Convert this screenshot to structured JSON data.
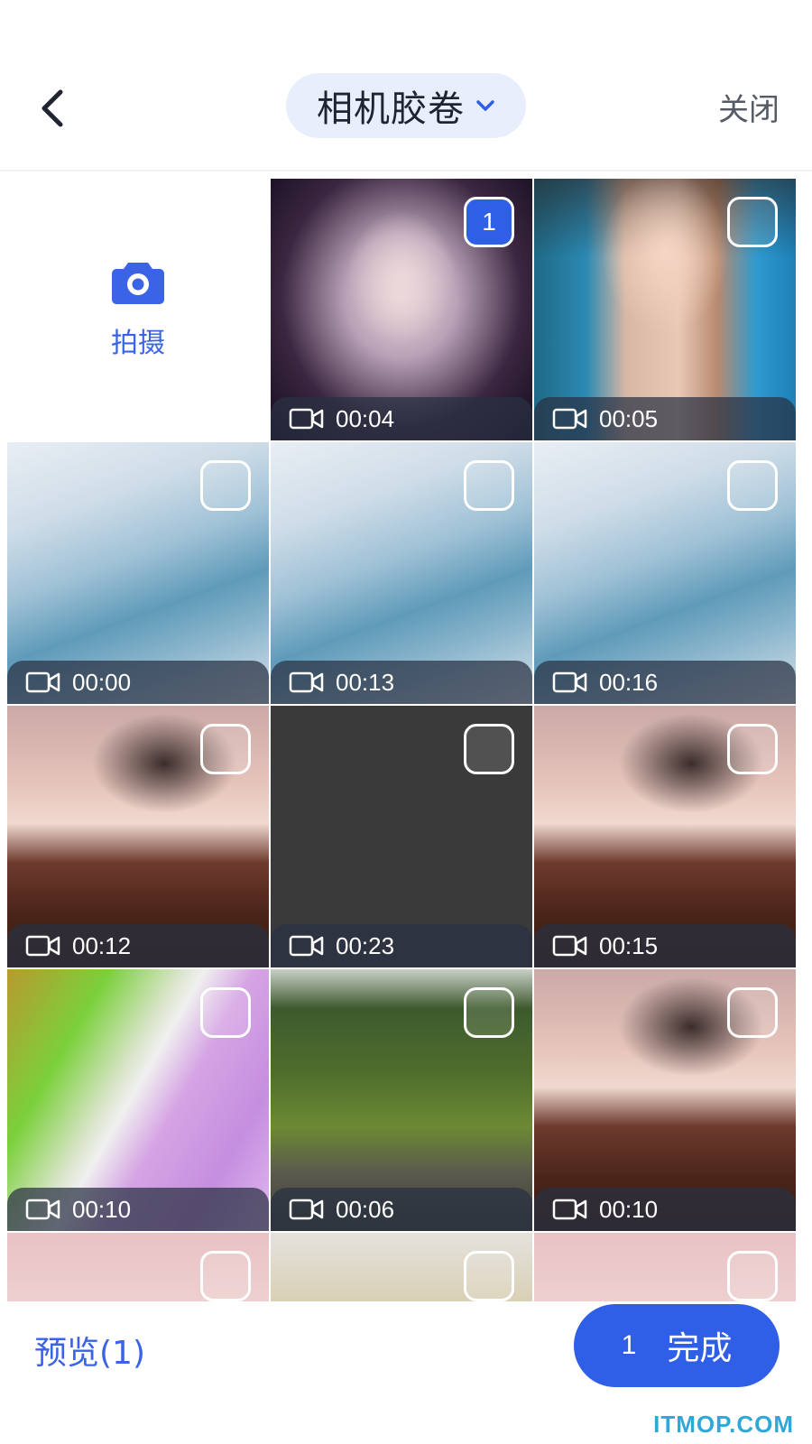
{
  "header": {
    "album_title": "相机胶卷",
    "close_label": "关闭"
  },
  "camera_tile": {
    "label": "拍摄"
  },
  "media": [
    {
      "duration": "00:04",
      "selected": true,
      "selection_index": "1",
      "thumb": "fantasy-girl-portrait"
    },
    {
      "duration": "00:05",
      "selected": false,
      "thumb": "woman-by-pool"
    },
    {
      "duration": "00:00",
      "selected": false,
      "thumb": "frozen-wave"
    },
    {
      "duration": "00:13",
      "selected": false,
      "thumb": "frozen-wave"
    },
    {
      "duration": "00:16",
      "selected": false,
      "thumb": "frozen-wave"
    },
    {
      "duration": "00:12",
      "selected": false,
      "thumb": "girl-on-table"
    },
    {
      "duration": "00:23",
      "selected": false,
      "thumb": "dark-blank"
    },
    {
      "duration": "00:15",
      "selected": false,
      "thumb": "girl-on-table"
    },
    {
      "duration": "00:10",
      "selected": false,
      "thumb": "abstract-color"
    },
    {
      "duration": "00:06",
      "selected": false,
      "thumb": "forest-river"
    },
    {
      "duration": "00:10",
      "selected": false,
      "thumb": "girl-on-table"
    },
    {
      "duration": "",
      "selected": false,
      "thumb": "doll-pink"
    },
    {
      "duration": "",
      "selected": false,
      "thumb": "beach-umbrella"
    },
    {
      "duration": "",
      "selected": false,
      "thumb": "doll-pink"
    }
  ],
  "footer": {
    "preview_label": "预览(1)",
    "done_count": "1",
    "done_label": "完成"
  },
  "watermark": "ITMOP.COM",
  "colors": {
    "accent": "#2f5fe6",
    "pill_bg": "#e8eefc"
  }
}
